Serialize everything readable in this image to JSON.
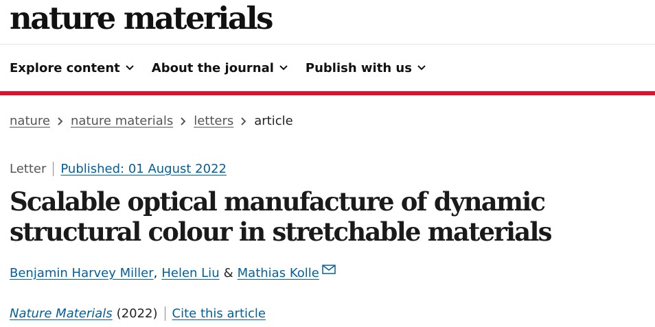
{
  "header": {
    "logo_text": "nature materials"
  },
  "nav": {
    "items": [
      {
        "label": "Explore content"
      },
      {
        "label": "About the journal"
      },
      {
        "label": "Publish with us"
      }
    ]
  },
  "breadcrumb": {
    "items": [
      "nature",
      "nature materials",
      "letters"
    ],
    "current": "article"
  },
  "article": {
    "type": "Letter",
    "published": "Published: 01 August 2022",
    "title": "Scalable optical manufacture of dynamic structural colour in stretchable materials",
    "authors": {
      "a1": "Benjamin Harvey Miller",
      "sep1": ",",
      "a2": "Helen Liu",
      "sep2": "&",
      "a3": "Mathias Kolle"
    },
    "journal": "Nature Materials",
    "year": "(2022)",
    "cite_label": "Cite this article"
  },
  "colors": {
    "accent_red": "#e0102a",
    "link_blue": "#00609f"
  },
  "icons": {
    "nav_chevron": "chevron-down-icon",
    "breadcrumb_sep": "chevron-right-icon",
    "contact": "mail-icon"
  }
}
